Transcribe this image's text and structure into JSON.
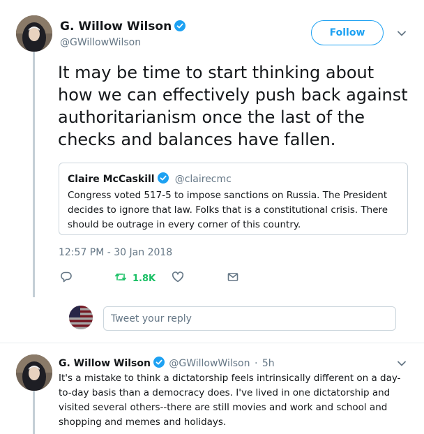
{
  "tweet": {
    "author_name": "G. Willow Wilson",
    "author_handle": "@GWillowWilson",
    "follow_label": "Follow",
    "text": "It may be time to start thinking about how we can effectively push back against authoritarianism once the last of the checks and balances have fallen.",
    "timestamp": "12:57 PM - 30 Jan 2018",
    "retweet_count": "1.8K"
  },
  "quote": {
    "author_name": "Claire McCaskill",
    "author_handle": "@clairecmc",
    "text": "Congress voted 517-5 to impose sanctions on Russia. The President decides to ignore that law. Folks that is a constitutional crisis. There should be outrage in every corner of this country."
  },
  "reply_box": {
    "placeholder": "Tweet your reply"
  },
  "reply": {
    "author_name": "G. Willow Wilson",
    "author_handle": "@GWillowWilson",
    "separator": "·",
    "time": "5h",
    "text": "It's a mistake to think a dictatorship feels intrinsically different on a day-to-day basis than a democracy does. I've lived in one dictatorship and visited several others--there are still movies and work and school and shopping and memes and holidays."
  },
  "icons": {
    "verified": "verified-badge-icon",
    "reply": "reply-icon",
    "retweet": "retweet-icon",
    "like": "heart-icon",
    "dm": "envelope-icon",
    "more": "chevron-down-icon"
  },
  "colors": {
    "accent": "#1da1f2",
    "retweet": "#17bf63",
    "muted": "#657786",
    "border": "#ccd6dd"
  }
}
